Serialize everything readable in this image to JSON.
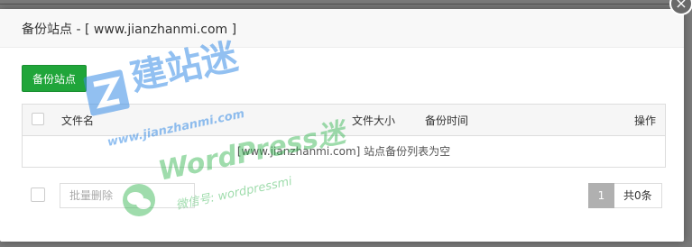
{
  "dialog": {
    "title": "备份站点 - [ www.jianzhanmi.com ]",
    "close_label": "×"
  },
  "toolbar": {
    "backup_button_label": "备份站点"
  },
  "table": {
    "columns": {
      "filename": "文件名",
      "filesize": "文件大小",
      "backup_time": "备份时间",
      "actions": "操作"
    },
    "empty_text": "[www.jianzhanmi.com] 站点备份列表为空"
  },
  "footer": {
    "batch_placeholder": "批量删除",
    "page_current": "1",
    "page_total": "共0条"
  },
  "watermark": {
    "brand": "建站迷",
    "url": "www.jianzhanmi.com",
    "wordpress": "WordPress迷",
    "wechat": "微信号: wordpressmi",
    "brand_color": "#3a8ee6",
    "wechat_color": "#2cb34a"
  }
}
